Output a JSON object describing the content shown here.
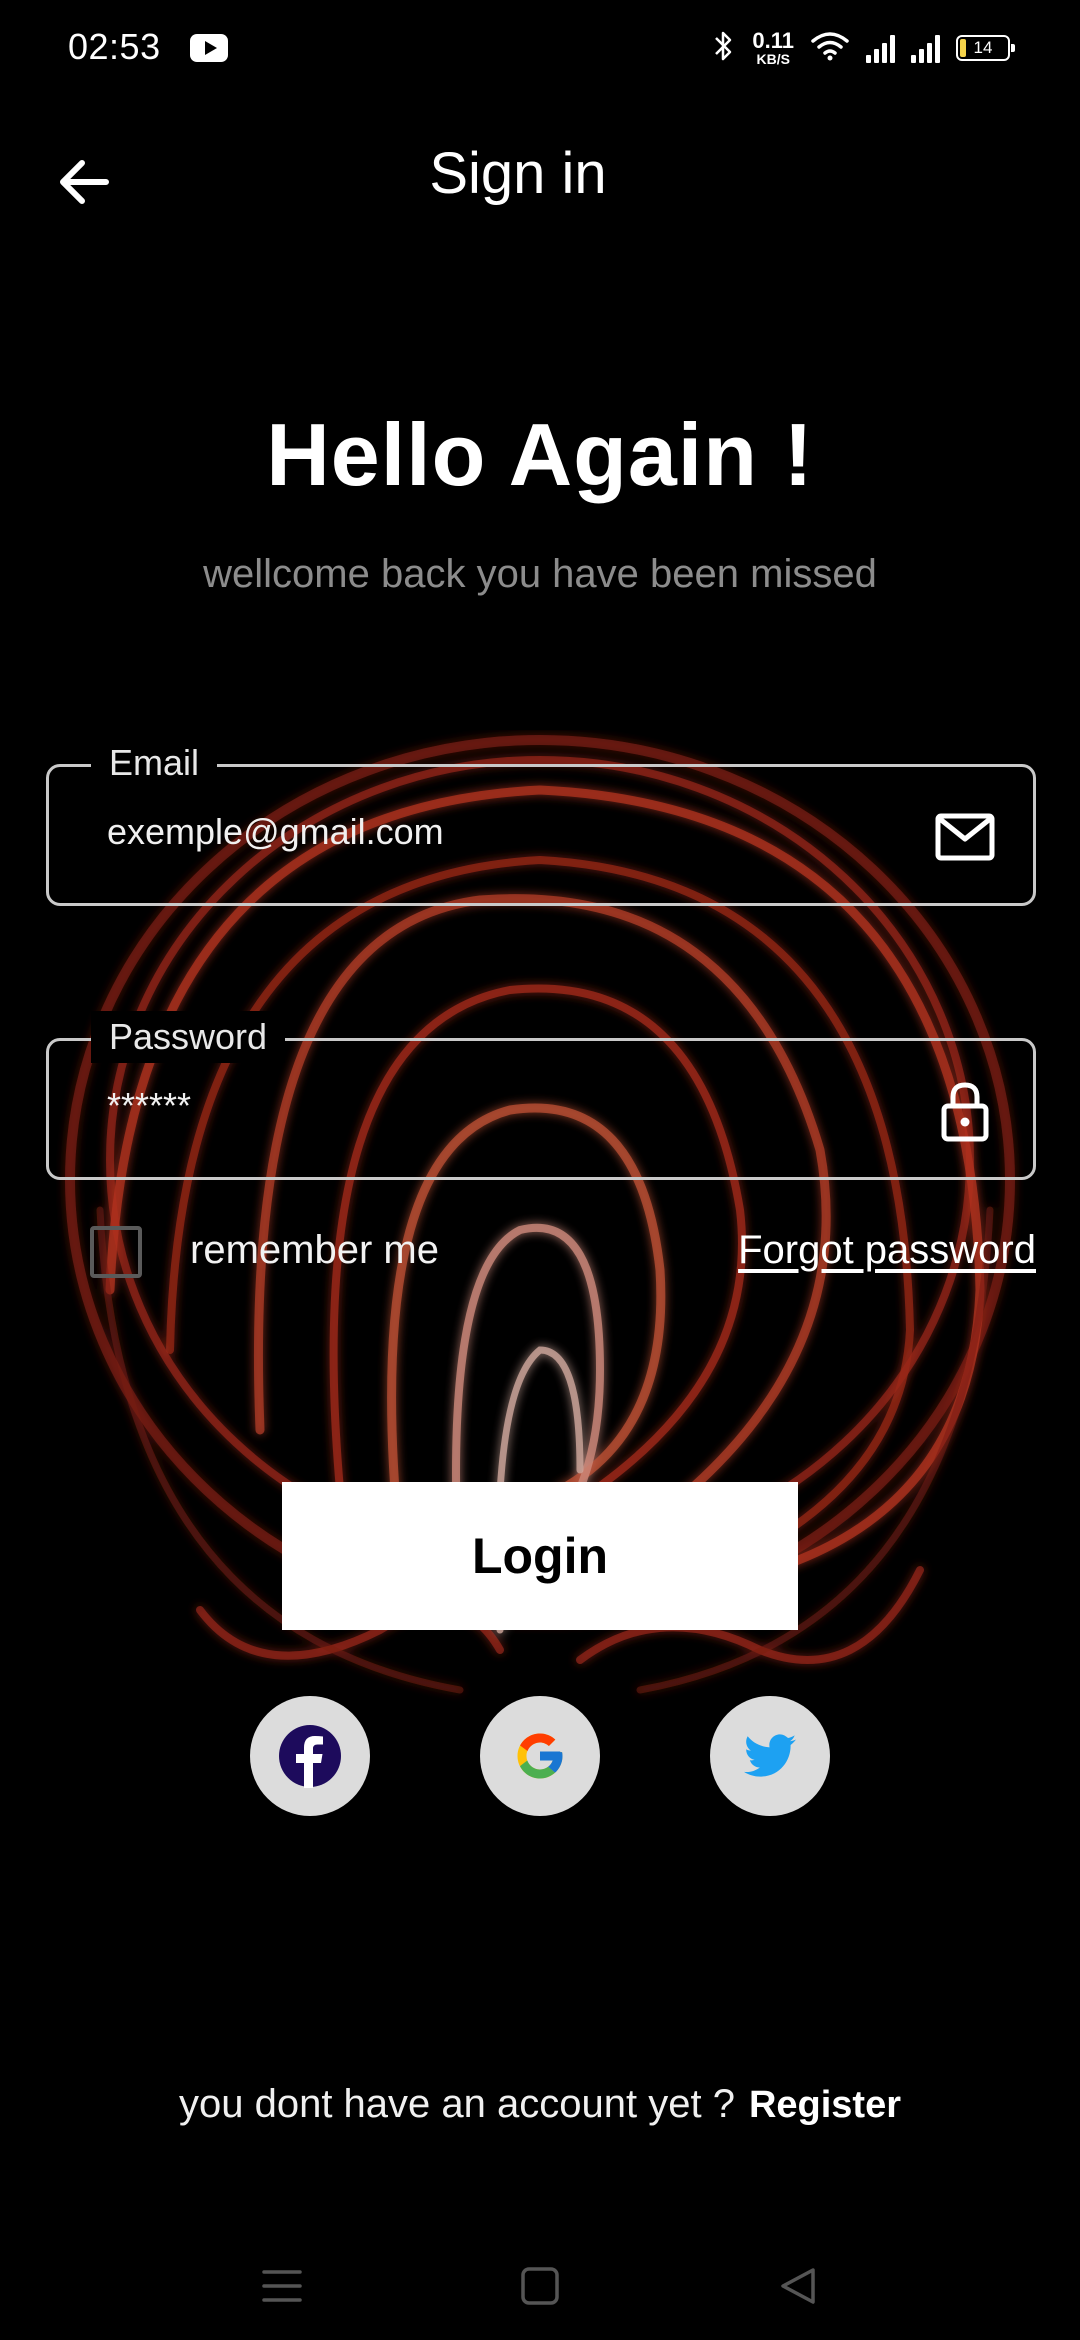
{
  "status_bar": {
    "time": "02:53",
    "net_speed_value": "0.11",
    "net_speed_unit": "KB/S",
    "battery_level": "14",
    "icons": [
      "youtube-icon",
      "bluetooth-icon",
      "wifi-icon",
      "signal-icon",
      "signal-icon",
      "battery-icon"
    ]
  },
  "header": {
    "title": "Sign in",
    "back_icon": "arrow-left-icon"
  },
  "greeting": {
    "title": "Hello Again !",
    "subtitle": "wellcome back you have been missed"
  },
  "form": {
    "email": {
      "label": "Email",
      "value": "exemple@gmail.com",
      "icon": "mail-icon"
    },
    "password": {
      "label": "Password",
      "value": "******",
      "icon": "lock-icon"
    },
    "remember_label": "remember me",
    "remember_checked": false,
    "forgot_label": "Forgot password",
    "login_label": "Login"
  },
  "social": {
    "providers": [
      "facebook-icon",
      "google-icon",
      "twitter-icon"
    ]
  },
  "footer": {
    "prompt": "you dont have an account yet ?",
    "register_label": "Register"
  },
  "colors": {
    "background": "#000000",
    "accent_red": "#c8341f",
    "facebook": "#1d0b5c",
    "twitter": "#1da1f2",
    "subtitle": "#8c8c8c"
  }
}
